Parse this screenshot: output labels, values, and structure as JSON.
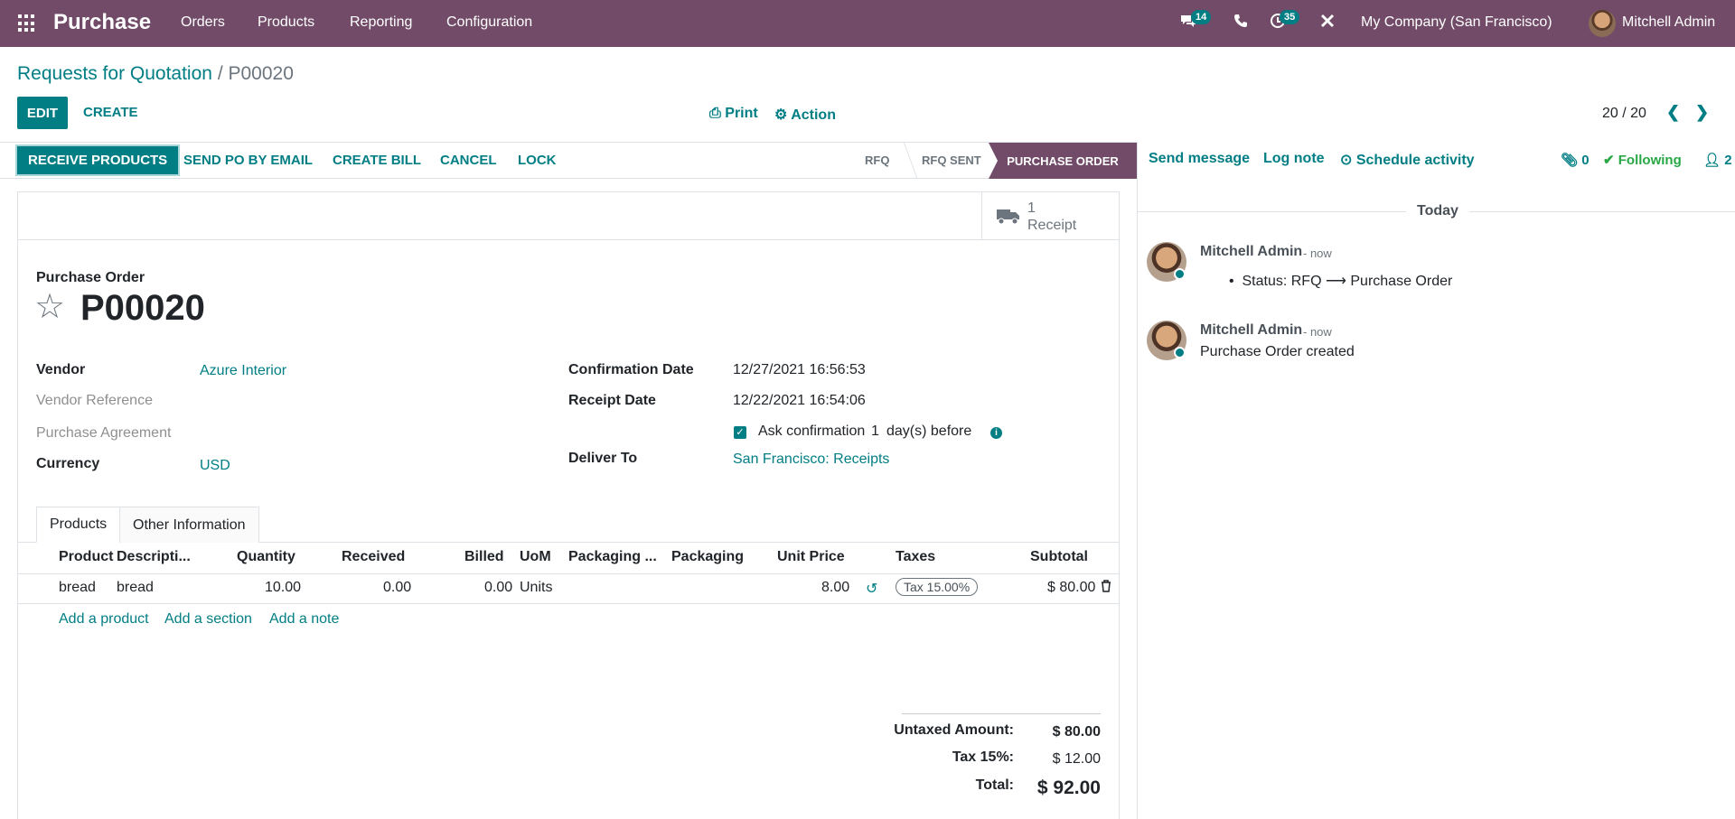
{
  "app": {
    "brand": "Purchase",
    "menu": [
      "Orders",
      "Products",
      "Reporting",
      "Configuration"
    ],
    "messages_badge": "14",
    "activities_badge": "35",
    "company": "My Company (San Francisco)",
    "user": "Mitchell Admin"
  },
  "control_panel": {
    "breadcrumb_parent": "Requests for Quotation",
    "breadcrumb_sep": "/",
    "breadcrumb_current": "P00020",
    "edit": "EDIT",
    "create": "CREATE",
    "print": "Print",
    "action": "Action",
    "pager": "20 / 20"
  },
  "statusbar": {
    "buttons": [
      "RECEIVE PRODUCTS",
      "SEND PO BY EMAIL",
      "CREATE BILL",
      "CANCEL",
      "LOCK"
    ],
    "stages": [
      "RFQ",
      "RFQ SENT",
      "PURCHASE ORDER"
    ],
    "active_stage": "PURCHASE ORDER"
  },
  "form": {
    "receipt_count": "1",
    "receipt_label": "Receipt",
    "doc_type": "Purchase Order",
    "name": "P00020",
    "fields_left": [
      {
        "label": "Vendor",
        "value": "Azure Interior"
      },
      {
        "label": "Vendor Reference",
        "value": ""
      },
      {
        "label": "Purchase Agreement",
        "value": ""
      },
      {
        "label": "Currency",
        "value": "USD"
      }
    ],
    "fields_right": {
      "confirmation_date_label": "Confirmation Date",
      "confirmation_date": "12/27/2021 16:56:53",
      "receipt_date_label": "Receipt Date",
      "receipt_date": "12/22/2021 16:54:06",
      "ask_confirmation": "Ask confirmation",
      "ask_days": "1",
      "ask_suffix": "day(s) before",
      "deliver_to_label": "Deliver To",
      "deliver_to": "San Francisco: Receipts"
    },
    "tabs": [
      "Products",
      "Other Information"
    ],
    "columns": [
      "Product",
      "Descripti...",
      "Quantity",
      "Received",
      "Billed",
      "UoM",
      "Packaging ...",
      "Packaging",
      "Unit Price",
      "Taxes",
      "Subtotal"
    ],
    "line": {
      "product": "bread",
      "description": "bread",
      "quantity": "10.00",
      "received": "0.00",
      "billed": "0.00",
      "uom": "Units",
      "unit_price": "8.00",
      "taxes": "Tax 15.00%",
      "subtotal": "$ 80.00"
    },
    "add_links": [
      "Add a product",
      "Add a section",
      "Add a note"
    ],
    "totals": {
      "untaxed_label": "Untaxed Amount:",
      "untaxed": "$ 80.00",
      "tax_label": "Tax 15%:",
      "tax": "$ 12.00",
      "total_label": "Total:",
      "total": "$ 92.00"
    }
  },
  "chatter": {
    "send_message": "Send message",
    "log_note": "Log note",
    "schedule_activity": "Schedule activity",
    "attachments": "0",
    "following": "Following",
    "followers": "2",
    "today": "Today",
    "messages": [
      {
        "author": "Mitchell Admin",
        "time": "- now",
        "body_prefix": "Status: RFQ",
        "arrow": "⟶",
        "body_suffix": "Purchase Order"
      },
      {
        "author": "Mitchell Admin",
        "time": "- now",
        "body": "Purchase Order created"
      }
    ]
  },
  "colors": {
    "brand": "#714B67",
    "accent": "#017e84"
  }
}
